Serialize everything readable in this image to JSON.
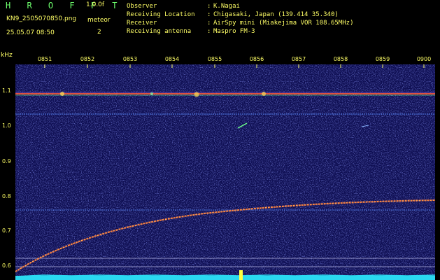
{
  "header": {
    "app_title": "H R O F F T",
    "version": "1.0.0f",
    "file_name": "KN9_2505070850.png",
    "meteor_label": "meteor",
    "date_time": "25.05.07 08:50",
    "meteor_count": "2"
  },
  "info": [
    {
      "label": "Observer",
      "value": "K.Nagai"
    },
    {
      "label": "Receiving Location",
      "value": "Chigasaki, Japan (139.414 35.340)"
    },
    {
      "label": "Receiver",
      "value": "AirSpy mini (Miakejima VOR 108.65MHz)"
    },
    {
      "label": "Receiving antenna",
      "value": "Maspro FM-3"
    }
  ],
  "axis": {
    "y_unit": "kHz",
    "y_ticks": [
      "1.1",
      "1.0",
      "0.9",
      "0.8",
      "0.7",
      "0.6"
    ],
    "x_ticks": [
      "0851",
      "0852",
      "0853",
      "0854",
      "0855",
      "0856",
      "0857",
      "0858",
      "0859",
      "0900"
    ]
  },
  "colors": {
    "label_green": "#6dff6d",
    "label_yellow": "#ffff66",
    "background_noise": "#0e0e52",
    "signal_line": "#ff7a3a",
    "power_trace": "#2ad8f0"
  }
}
